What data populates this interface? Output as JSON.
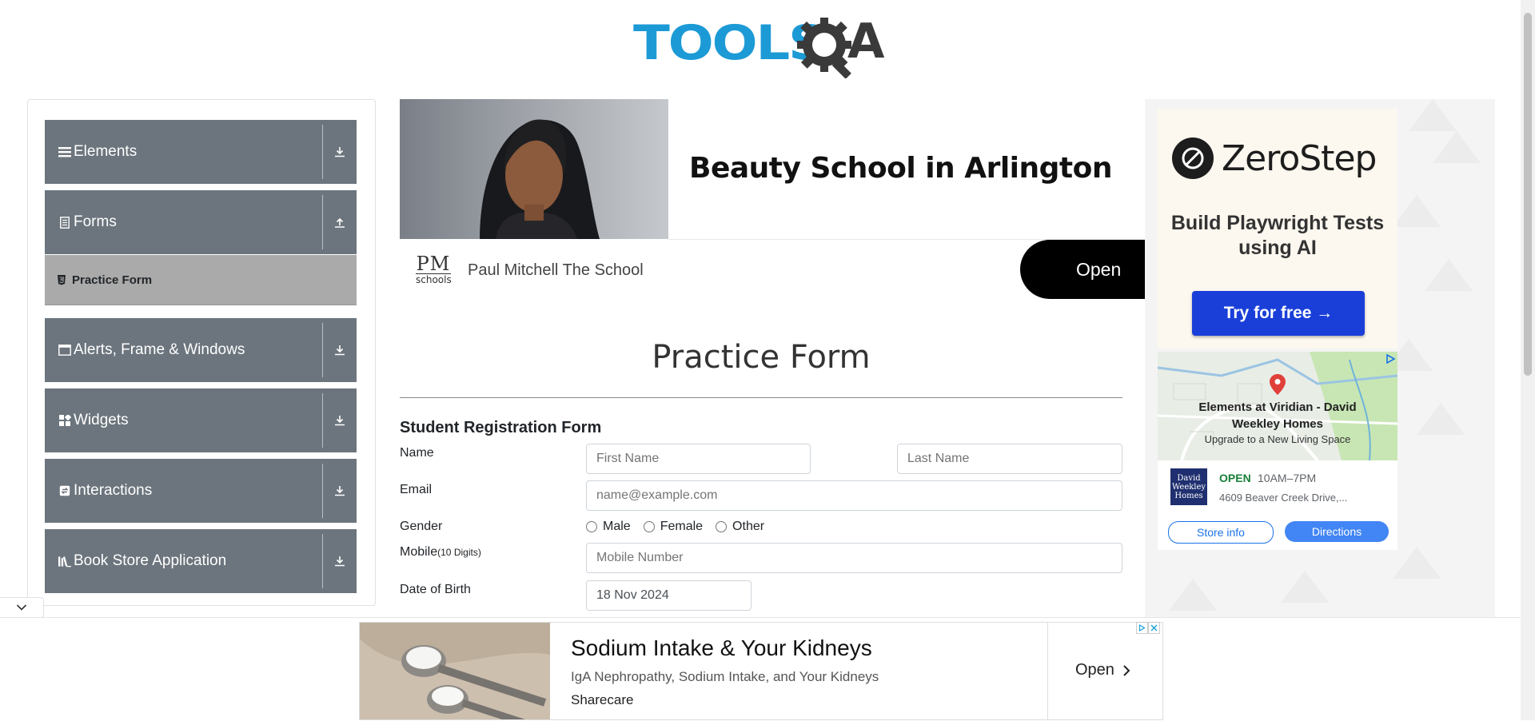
{
  "header": {
    "logo_text": "TOOLSQA",
    "logo_primary": "TOOLS",
    "logo_secondary": "A",
    "brand_color": "#1c9ad6"
  },
  "sidebar": {
    "groups": [
      {
        "label": "Elements",
        "icon": "hamburger-icon"
      },
      {
        "label": "Forms",
        "icon": "document-icon"
      },
      {
        "label": "Alerts, Frame & Windows",
        "icon": "window-icon"
      },
      {
        "label": "Widgets",
        "icon": "grid-icon"
      },
      {
        "label": "Interactions",
        "icon": "interaction-icon"
      },
      {
        "label": "Book Store Application",
        "icon": "books-icon"
      }
    ],
    "active_sub_item": "Practice Form",
    "group_color": "#6c757d",
    "active_color": "#aaaaaa"
  },
  "banner_ad": {
    "title": "Beauty School in Arlington",
    "logo_line1": "PM",
    "logo_line2": "schools",
    "advertiser": "Paul Mitchell The School",
    "cta": "Open"
  },
  "form": {
    "page_title": "Practice Form",
    "subtitle": "Student Registration Form",
    "name_label": "Name",
    "first_name_placeholder": "First Name",
    "last_name_placeholder": "Last Name",
    "email_label": "Email",
    "email_placeholder": "name@example.com",
    "gender_label": "Gender",
    "gender_options": [
      "Male",
      "Female",
      "Other"
    ],
    "mobile_label": "Mobile",
    "mobile_hint": "(10 Digits)",
    "mobile_placeholder": "Mobile Number",
    "dob_label": "Date of Birth",
    "dob_value": "18 Nov 2024"
  },
  "right_ad": {
    "brand": "ZeroStep",
    "tagline": "Build Playwright Tests using AI",
    "cta": "Try for free →",
    "map_title": "Elements at Viridian - David Weekley Homes",
    "map_subtitle": "Upgrade to a New Living Space",
    "logo_text": "David Weekley Homes",
    "status": "OPEN",
    "hours": "10AM–7PM",
    "address": "4609 Beaver Creek Drive,...",
    "store_info": "Store info",
    "directions": "Directions"
  },
  "bottom_ad": {
    "title": "Sodium Intake & Your Kidneys",
    "description": "IgA Nephropathy, Sodium Intake, and Your Kidneys",
    "brand": "Sharecare",
    "cta": "Open"
  }
}
